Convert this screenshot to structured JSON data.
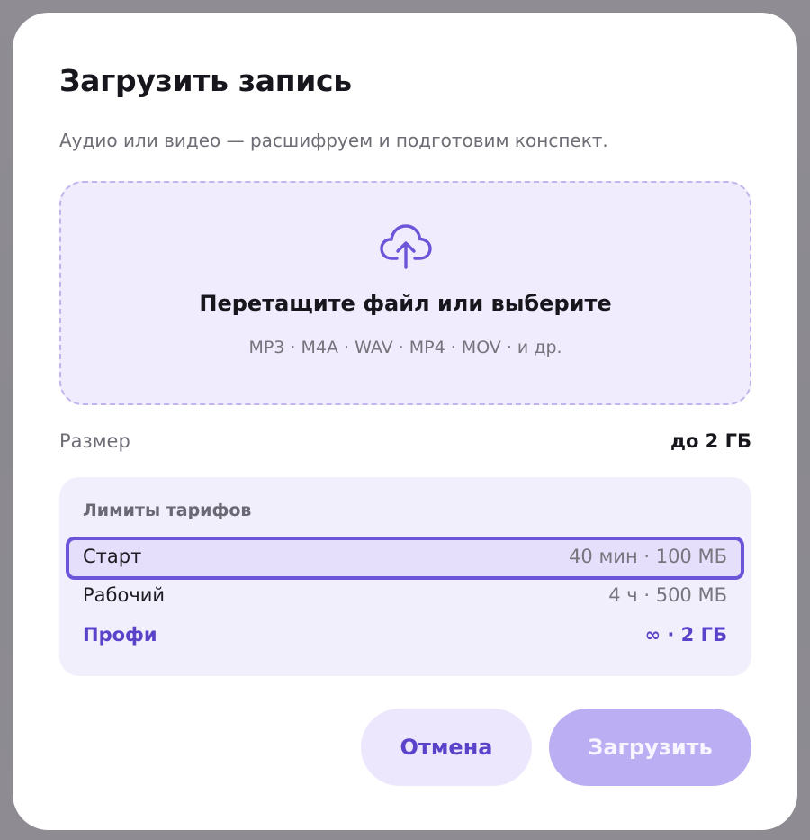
{
  "dialog": {
    "title": "Загрузить запись",
    "subtitle": "Аудио или видео — расшифруем и подготовим конспект."
  },
  "dropzone": {
    "icon": "cloud-upload-icon",
    "title": "Перетащите файл или выберите",
    "formats": "MP3 · M4A · WAV · MP4 · MOV · и др."
  },
  "size": {
    "label": "Размер",
    "value": "до 2 ГБ"
  },
  "limits": {
    "title": "Лимиты тарифов",
    "plans": [
      {
        "name": "Старт",
        "limit": "40 мин · 100 МБ",
        "selected": true
      },
      {
        "name": "Рабочий",
        "limit": "4 ч · 500 МБ",
        "selected": false
      },
      {
        "name": "Профи",
        "limit": "∞ · 2 ГБ",
        "selected": false
      }
    ]
  },
  "buttons": {
    "cancel": "Отмена",
    "upload": "Загрузить"
  },
  "colors": {
    "accent": "#6c55d8",
    "accent_text": "#5b43c9",
    "dropzone_bg": "#f0ecfd",
    "upload_button_bg": "#bcaef3"
  }
}
